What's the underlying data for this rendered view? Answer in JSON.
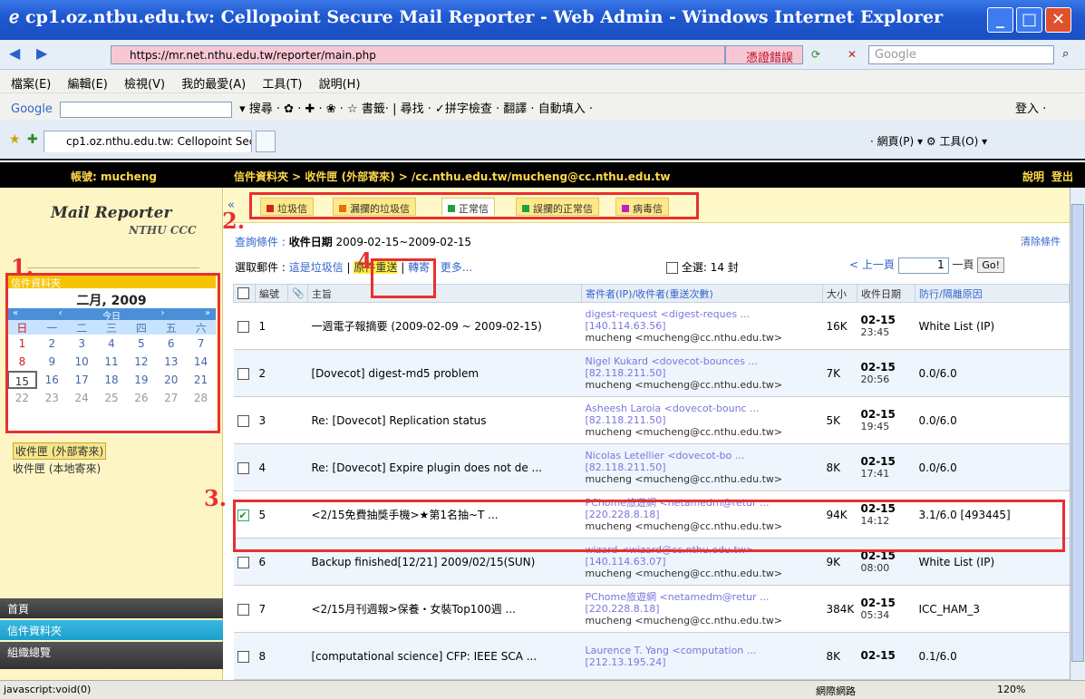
{
  "window": {
    "title": "cp1.oz.ntbu.edu.tw: Cellopoint Secure Mail Reporter - Web Admin - Windows Internet Explorer"
  },
  "browser": {
    "url": "https://mr.net.nthu.edu.tw/reporter/main.php",
    "cert_error": "憑證錯誤",
    "search_placeholder": "Google",
    "menu": [
      "檔案(E)",
      "編輯(E)",
      "檢視(V)",
      "我的最愛(A)",
      "工具(T)",
      "說明(H)"
    ],
    "google_label": "Google",
    "gtoolbar": "▾ 搜尋 · ✿ · ✚ · ❀ · ☆ 書籤· | 尋找 · ✓拼字檢查 · 翻譯 · 自動填入 ·",
    "gtoolbar_right": "登入 ·",
    "tab_title": "cp1.oz.nthu.edu.tw: Cellopoint Sec...",
    "tab_right": "· 網頁(P) ▾ ⚙ 工具(O) ▾"
  },
  "header": {
    "account": "帳號: mucheng",
    "breadcrumb": "信件資料夾 > 收件匣 (外部寄來) > /cc.nthu.edu.tw/mucheng@cc.nthu.edu.tw",
    "help": "說明",
    "logout": "登出"
  },
  "sidebar": {
    "logo_title": "Mail Reporter",
    "logo_sub": "NTHU CCC",
    "folders_label": "信件資料夾",
    "calendar": {
      "month": "二月, 2009",
      "nav_prev2": "«",
      "nav_prev": "‹",
      "nav_today": "今日",
      "nav_next": "›",
      "nav_next2": "»",
      "weekdays": [
        "日",
        "一",
        "二",
        "三",
        "四",
        "五",
        "六"
      ],
      "days": [
        "1",
        "2",
        "3",
        "4",
        "5",
        "6",
        "7",
        "8",
        "9",
        "10",
        "11",
        "12",
        "13",
        "14",
        "15",
        "16",
        "17",
        "18",
        "19",
        "20",
        "21",
        "22",
        "23",
        "24",
        "25",
        "26",
        "27",
        "28"
      ]
    },
    "inbox_external": "收件匣 (外部寄來)",
    "inbox_local": "收件匣 (本地寄來)",
    "nav_home": "首頁",
    "nav_folders": "信件資料夾",
    "nav_org": "組織總覽"
  },
  "filters": {
    "tabs": [
      {
        "label": "垃圾信",
        "color": "#d42020"
      },
      {
        "label": "漏攔的垃圾信",
        "color": "#e07010"
      },
      {
        "label": "正常信",
        "color": "#20a040"
      },
      {
        "label": "誤攔的正常信",
        "color": "#20a040"
      },
      {
        "label": "病毒信",
        "color": "#c020c0"
      }
    ]
  },
  "query": {
    "prefix": "查詢條件 :",
    "field": "收件日期",
    "range": "2009-02-15~2009-02-15",
    "clear": "清除條件"
  },
  "selection": {
    "label": "選取郵件 :",
    "mark_spam": "這是垃圾信",
    "resend": "原件重送",
    "forward": "轉寄",
    "more": "更多...",
    "select_all": "全選: 14 封",
    "prev": "< 上一頁",
    "page": "1",
    "page_suffix": "一頁",
    "go": "Go!"
  },
  "table": {
    "headers": [
      "",
      "編號",
      "📎",
      "主旨",
      "寄件者(IP)/收件者(重送次數)",
      "大小",
      "收件日期",
      "防行/隔離原因"
    ],
    "rows": [
      {
        "checked": false,
        "num": "1",
        "subject": "一週電子報摘要 (2009-02-09 ~ 2009-02-15)",
        "s1": "digest-request <digest-reques ...",
        "s2": "[140.114.63.56]",
        "s3": "mucheng <mucheng@cc.nthu.edu.tw>",
        "size": "16K",
        "date": "02-15",
        "time": "23:45",
        "reason": "White List (IP)"
      },
      {
        "checked": false,
        "num": "2",
        "subject": "[Dovecot] digest-md5 problem",
        "s1": "Nigel Kukard <dovecot-bounces ...",
        "s2": "[82.118.211.50]",
        "s3": "mucheng <mucheng@cc.nthu.edu.tw>",
        "size": "7K",
        "date": "02-15",
        "time": "20:56",
        "reason": "0.0/6.0"
      },
      {
        "checked": false,
        "num": "3",
        "subject": "Re: [Dovecot] Replication status",
        "s1": "Asheesh Laroia <dovecot-bounc ...",
        "s2": "[82.118.211.50]",
        "s3": "mucheng <mucheng@cc.nthu.edu.tw>",
        "size": "5K",
        "date": "02-15",
        "time": "19:45",
        "reason": "0.0/6.0"
      },
      {
        "checked": false,
        "num": "4",
        "subject": "Re: [Dovecot] Expire plugin does not de ...",
        "s1": "Nicolas Letellier <dovecot-bo ...",
        "s2": "[82.118.211.50]",
        "s3": "mucheng <mucheng@cc.nthu.edu.tw>",
        "size": "8K",
        "date": "02-15",
        "time": "17:41",
        "reason": "0.0/6.0"
      },
      {
        "checked": true,
        "num": "5",
        "subject": "<2/15免費抽獎手機>★第1名抽~T ...",
        "s1": "PChome旅遊網 <netamedm@retur ...",
        "s2": "[220.228.8.18]",
        "s3": "mucheng <mucheng@cc.nthu.edu.tw>",
        "size": "94K",
        "date": "02-15",
        "time": "14:12",
        "reason": "3.1/6.0 [493445]"
      },
      {
        "checked": false,
        "num": "6",
        "subject": "Backup finished[12/21] 2009/02/15(SUN)",
        "s1": "wizard <wizard@cc.nthu.edu.tw>",
        "s2": "[140.114.63.07]",
        "s3": "mucheng <mucheng@cc.nthu.edu.tw>",
        "size": "9K",
        "date": "02-15",
        "time": "08:00",
        "reason": "White List (IP)"
      },
      {
        "checked": false,
        "num": "7",
        "subject": "<2/15月刊週報>保養・女裝Top100週 ...",
        "s1": "PChome旅遊網 <netamedm@retur ...",
        "s2": "[220.228.8.18]",
        "s3": "mucheng <mucheng@cc.nthu.edu.tw>",
        "size": "384K",
        "date": "02-15",
        "time": "05:34",
        "reason": "ICC_HAM_3"
      },
      {
        "checked": false,
        "num": "8",
        "subject": "[computational science] CFP: IEEE SCA ...",
        "s1": "Laurence T. Yang <computation ...",
        "s2": "[212.13.195.24]",
        "s3": "",
        "size": "8K",
        "date": "02-15",
        "time": "",
        "reason": "0.1/6.0"
      }
    ]
  },
  "annotations": [
    "1.",
    "2.",
    "3.",
    "4"
  ],
  "status": {
    "left": "javascript:void(0)",
    "zone": "網際網路",
    "zoom": "120%"
  }
}
